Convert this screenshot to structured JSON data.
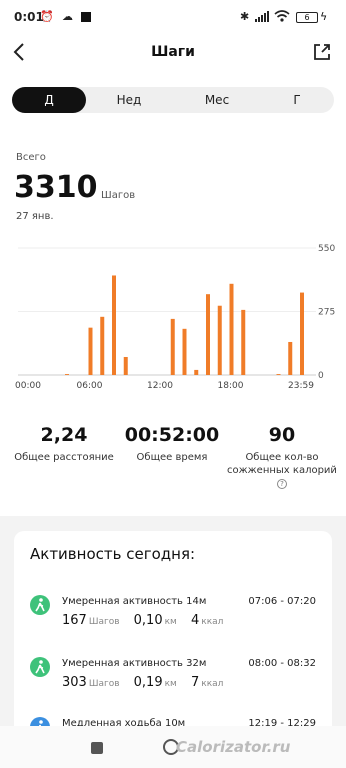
{
  "status_bar": {
    "time": "0:01",
    "battery": "6"
  },
  "header": {
    "title": "Шаги"
  },
  "tabs": [
    {
      "label": "Д",
      "active": true
    },
    {
      "label": "Нед",
      "active": false
    },
    {
      "label": "Мес",
      "active": false
    },
    {
      "label": "Г",
      "active": false
    }
  ],
  "summary": {
    "label": "Всего",
    "value": "3310",
    "unit": "Шагов",
    "date": "27 янв."
  },
  "chart_data": {
    "type": "bar",
    "color": "#f07c28",
    "x_ticks": [
      "00:00",
      "06:00",
      "12:00",
      "18:00",
      "23:59"
    ],
    "y_ticks": [
      "550",
      "275",
      "0"
    ],
    "ylim": [
      0,
      550
    ],
    "hours": [
      0,
      1,
      2,
      3,
      4,
      5,
      6,
      7,
      8,
      9,
      10,
      11,
      12,
      13,
      14,
      15,
      16,
      17,
      18,
      19,
      20,
      21,
      22,
      23
    ],
    "values": [
      0,
      0,
      0,
      0,
      4,
      0,
      205,
      252,
      431,
      78,
      0,
      0,
      0,
      243,
      200,
      22,
      350,
      300,
      395,
      282,
      0,
      0,
      4,
      143,
      357
    ]
  },
  "stats": [
    {
      "value": "2,24",
      "label": "Общее расстояние"
    },
    {
      "value": "00:52:00",
      "label": "Общее время"
    },
    {
      "value": "90",
      "label": "Общее кол-во сожженных калорий"
    }
  ],
  "activity": {
    "title": "Активность сегодня:",
    "items": [
      {
        "name": "Умеренная активность 14м",
        "time_range": "07:06 - 07:20",
        "steps": "167",
        "steps_unit": "Шагов",
        "distance": "0,10",
        "distance_unit": "км",
        "kcal": "4",
        "kcal_unit": "ккал",
        "icon_color": "#3ec27a"
      },
      {
        "name": "Умеренная активность 32м",
        "time_range": "08:00 - 08:32",
        "steps": "303",
        "steps_unit": "Шагов",
        "distance": "0,19",
        "distance_unit": "км",
        "kcal": "7",
        "kcal_unit": "ккал",
        "icon_color": "#3ec27a"
      },
      {
        "name": "Медленная ходьба 10м",
        "time_range": "12:19 - 12:29",
        "icon_color": "#3b8fe0"
      }
    ]
  },
  "watermark": "Calorizator.ru"
}
